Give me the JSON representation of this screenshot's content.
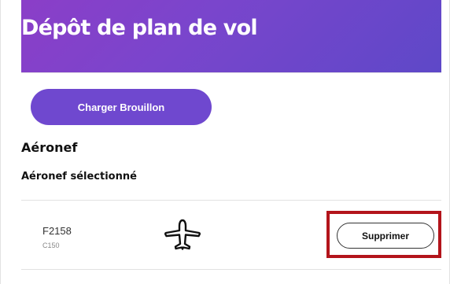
{
  "header": {
    "title": "Dépôt de plan de vol"
  },
  "actions": {
    "load_draft_label": "Charger Brouillon"
  },
  "aircraft_section": {
    "title": "Aéronef",
    "selected_title": "Aéronef sélectionné",
    "selected_aircraft": {
      "registration": "F2158",
      "type": "C150",
      "icon": "airplane-icon",
      "delete_label": "Supprimer"
    }
  },
  "colors": {
    "banner_start": "#8b3ec8",
    "banner_end": "#5e48c8",
    "primary_button": "#6f48cf",
    "highlight": "#b3141b"
  }
}
